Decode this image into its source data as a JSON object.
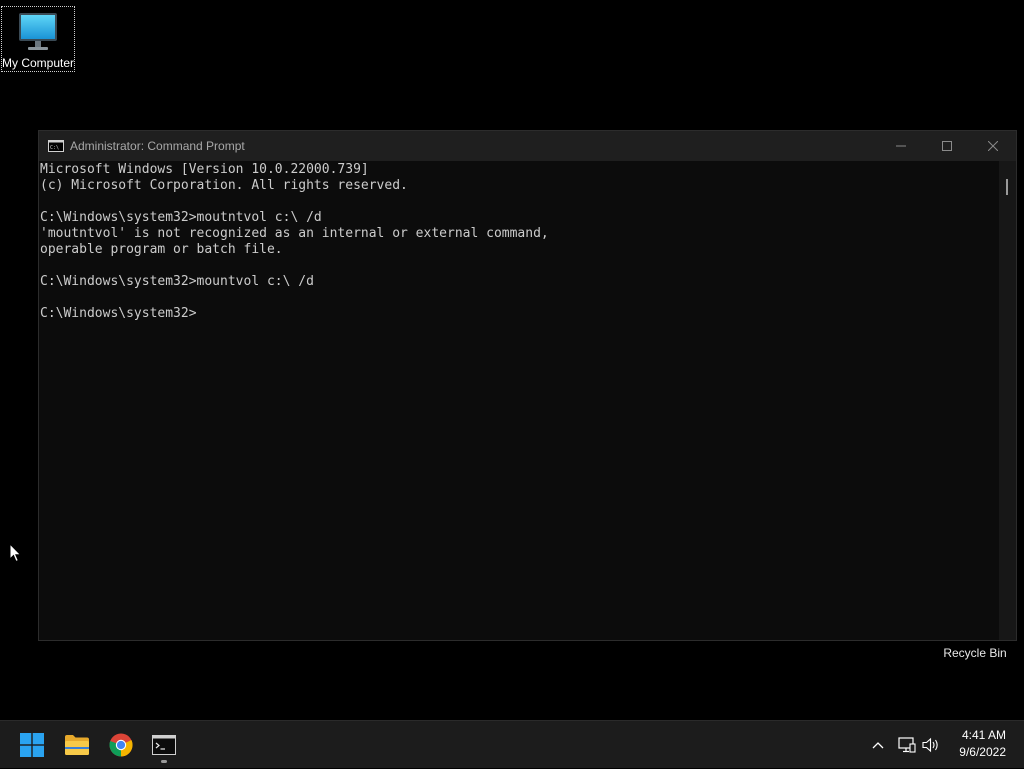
{
  "desktop": {
    "icons": [
      {
        "label": "My Computer",
        "icon": "monitor-icon"
      },
      {
        "label": "Recycle Bin",
        "icon": "recycle-bin-icon"
      }
    ]
  },
  "window": {
    "title": "Administrator: Command Prompt",
    "icon": "console-icon",
    "controls": [
      "minimize-icon",
      "maximize-icon",
      "close-icon"
    ],
    "console_lines": [
      "Microsoft Windows [Version 10.0.22000.739]",
      "(c) Microsoft Corporation. All rights reserved.",
      "",
      "C:\\Windows\\system32>moutntvol c:\\ /d",
      "'moutntvol' is not recognized as an internal or external command,",
      "operable program or batch file.",
      "",
      "C:\\Windows\\system32>mountvol c:\\ /d",
      "",
      "C:\\Windows\\system32>"
    ],
    "colors": {
      "console_bg": "#0c0c0c",
      "console_fg": "#cccccc",
      "titlebar_bg": "#1f1f1f"
    }
  },
  "taskbar": {
    "apps": [
      {
        "name": "Start",
        "icon": "windows-start-icon"
      },
      {
        "name": "File Explorer",
        "icon": "folder-icon"
      },
      {
        "name": "Google Chrome",
        "icon": "chrome-icon"
      },
      {
        "name": "Command Prompt",
        "icon": "console-icon",
        "active": true
      }
    ],
    "tray": [
      "chevron-up-icon",
      "network-icon",
      "volume-icon"
    ],
    "time": "4:41 AM",
    "date": "9/6/2022"
  }
}
